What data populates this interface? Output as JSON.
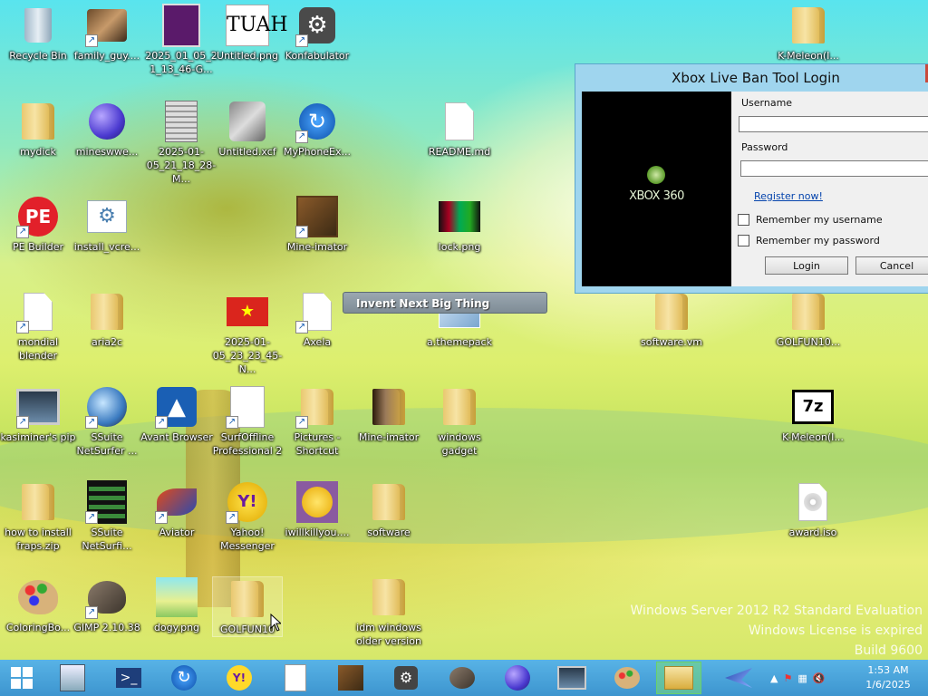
{
  "desktop": {
    "icons": [
      {
        "label": "Recycle Bin",
        "icon": "recycle-bin-icon"
      },
      {
        "label": "family_guy....",
        "icon": "image-icon"
      },
      {
        "label": "2025_01_05_21_13_46-G...",
        "icon": "screenshot-icon"
      },
      {
        "label": "Untitled.png",
        "icon": "image-icon"
      },
      {
        "label": "Konfabulator",
        "icon": "konfabulator-icon"
      },
      {
        "label": "K-Meleon(I...",
        "icon": "folder-icon"
      },
      {
        "label": "mydick",
        "icon": "folder-icon"
      },
      {
        "label": "mineswwe...",
        "icon": "minesweeper-icon"
      },
      {
        "label": "2025-01-05_21_18_28-M...",
        "icon": "screenshot-icon"
      },
      {
        "label": "Untitled.xcf",
        "icon": "gimp-file-icon"
      },
      {
        "label": "MyPhoneEx...",
        "icon": "myphoneexplorer-icon"
      },
      {
        "label": "README.md",
        "icon": "document-icon"
      },
      {
        "label": "PE Builder",
        "icon": "pe-builder-icon"
      },
      {
        "label": "install_vcre...",
        "icon": "installer-icon"
      },
      {
        "label": "Mine-imator",
        "icon": "mine-imator-icon"
      },
      {
        "label": "lock.png",
        "icon": "image-icon"
      },
      {
        "label": "mondial blender",
        "icon": "document-icon"
      },
      {
        "label": "aria2c",
        "icon": "folder-icon"
      },
      {
        "label": "2025-01-05_23_23_45-N...",
        "icon": "flag-image-icon"
      },
      {
        "label": "Axela",
        "icon": "document-icon"
      },
      {
        "label": "a.themepack",
        "icon": "themepack-icon"
      },
      {
        "label": "software.vm",
        "icon": "folder-icon"
      },
      {
        "label": "GOLFUN10...",
        "icon": "folder-icon"
      },
      {
        "label": "kasiminer's pip",
        "icon": "monitor-icon"
      },
      {
        "label": "SSuite NetSurfer ...",
        "icon": "globe-icon"
      },
      {
        "label": "Avant Browser",
        "icon": "avant-browser-icon"
      },
      {
        "label": "SurfOffline Professional 2",
        "icon": "surfoffline-icon"
      },
      {
        "label": "Pictures - Shortcut",
        "icon": "folder-icon"
      },
      {
        "label": "Mine-imator",
        "icon": "folder-icon"
      },
      {
        "label": "windows gadget",
        "icon": "folder-icon"
      },
      {
        "label": "K-Meleon(I...",
        "icon": "7zip-icon"
      },
      {
        "label": "how to install fraps.zip",
        "icon": "zip-folder-icon"
      },
      {
        "label": "SSuite NetSurfi...",
        "icon": "film-icon"
      },
      {
        "label": "Aviator",
        "icon": "aviator-icon"
      },
      {
        "label": "Yahoo! Messenger",
        "icon": "yahoo-messenger-icon"
      },
      {
        "label": "iwillkillyou....",
        "icon": "smiley-icon"
      },
      {
        "label": "software",
        "icon": "folder-icon"
      },
      {
        "label": "award.iso",
        "icon": "disc-image-icon"
      },
      {
        "label": "ColoringBo...",
        "icon": "paint-palette-icon"
      },
      {
        "label": "GIMP 2.10.38",
        "icon": "gimp-icon"
      },
      {
        "label": "dogy.png",
        "icon": "image-icon"
      },
      {
        "label": "GOLFUN10",
        "icon": "folder-icon"
      },
      {
        "label": "idm windows older version",
        "icon": "folder-icon"
      }
    ]
  },
  "login_window": {
    "title": "Xbox Live Ban Tool Login",
    "logo_text": "XBOX 360",
    "username_label": "Username",
    "username_value": "",
    "password_label": "Password",
    "password_value": "",
    "register_link": "Register now!",
    "remember_username": "Remember my username",
    "remember_password": "Remember my password",
    "login_button": "Login",
    "cancel_button": "Cancel"
  },
  "tooltip": "Invent Next Big Thing",
  "watermark": {
    "line1": "Windows Server 2012 R2 Standard Evaluation",
    "line2": "Windows License is expired",
    "line3": "Build 9600"
  },
  "taskbar": {
    "items": [
      "start-icon",
      "server-manager-icon",
      "powershell-icon",
      "myphoneexplorer-icon",
      "yahoo-messenger-icon",
      "document-icon",
      "mine-imator-icon",
      "konfabulator-icon",
      "gimp-icon",
      "minesweeper-icon",
      "monitor-icon",
      "paint-palette-icon",
      "file-explorer-icon",
      "aviator-icon"
    ],
    "clock_time": "1:53 AM",
    "clock_date": "1/6/2025"
  }
}
